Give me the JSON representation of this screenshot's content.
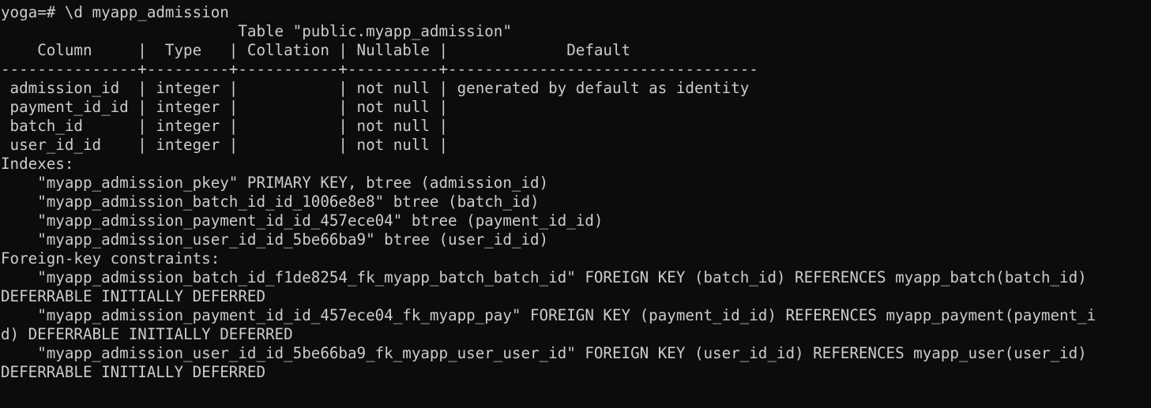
{
  "terminal": {
    "lines": [
      "yoga=# \\d myapp_admission",
      "                          Table \"public.myapp_admission\"",
      "    Column     |  Type   | Collation | Nullable |             Default",
      "---------------+---------+-----------+----------+----------------------------------",
      " admission_id  | integer |           | not null | generated by default as identity",
      " payment_id_id | integer |           | not null |",
      " batch_id      | integer |           | not null |",
      " user_id_id    | integer |           | not null |",
      "Indexes:",
      "    \"myapp_admission_pkey\" PRIMARY KEY, btree (admission_id)",
      "    \"myapp_admission_batch_id_id_1006e8e8\" btree (batch_id)",
      "    \"myapp_admission_payment_id_id_457ece04\" btree (payment_id_id)",
      "    \"myapp_admission_user_id_id_5be66ba9\" btree (user_id_id)",
      "Foreign-key constraints:",
      "    \"myapp_admission_batch_id_f1de8254_fk_myapp_batch_batch_id\" FOREIGN KEY (batch_id) REFERENCES myapp_batch(batch_id)",
      "DEFERRABLE INITIALLY DEFERRED",
      "    \"myapp_admission_payment_id_id_457ece04_fk_myapp_pay\" FOREIGN KEY (payment_id_id) REFERENCES myapp_payment(payment_i",
      "d) DEFERRABLE INITIALLY DEFERRED",
      "    \"myapp_admission_user_id_id_5be66ba9_fk_myapp_user_user_id\" FOREIGN KEY (user_id_id) REFERENCES myapp_user(user_id)",
      "DEFERRABLE INITIALLY DEFERRED"
    ]
  }
}
